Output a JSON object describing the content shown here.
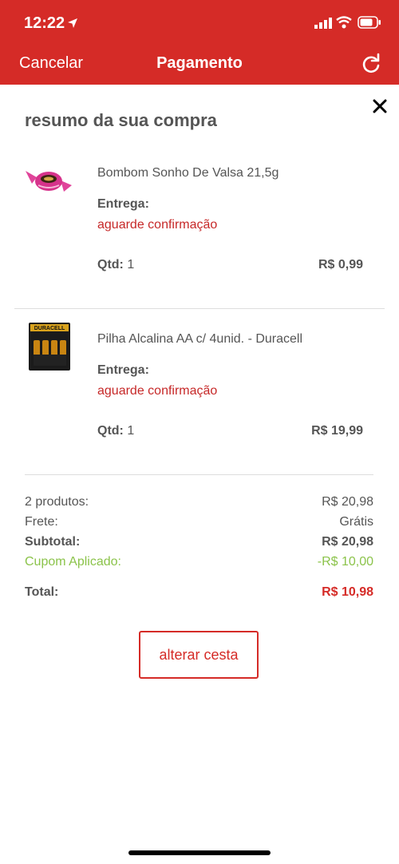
{
  "status_bar": {
    "time": "12:22"
  },
  "nav": {
    "cancel_label": "Cancelar",
    "title": "Pagamento"
  },
  "summary": {
    "title": "resumo da sua compra",
    "products": [
      {
        "name": "Bombom Sonho De Valsa 21,5g",
        "delivery_label": "Entrega:",
        "delivery_status": "aguarde confirmação",
        "qty_label": "Qtd:",
        "qty": "1",
        "price": "R$ 0,99"
      },
      {
        "name": "Pilha Alcalina AA c/ 4unid. - Duracell",
        "delivery_label": "Entrega:",
        "delivery_status": "aguarde confirmação",
        "qty_label": "Qtd:",
        "qty": "1",
        "price": "R$ 19,99",
        "image_text": "DURACELL"
      }
    ],
    "totals": {
      "products_label": "2 produtos:",
      "products_value": "R$ 20,98",
      "shipping_label": "Frete:",
      "shipping_value": "Grátis",
      "subtotal_label": "Subtotal:",
      "subtotal_value": "R$ 20,98",
      "coupon_label": "Cupom Aplicado:",
      "coupon_value": "-R$ 10,00",
      "total_label": "Total:",
      "total_value": "R$ 10,98"
    },
    "change_button": "alterar cesta"
  },
  "colors": {
    "brand": "#d52b27",
    "coupon": "#8bc34a",
    "text": "#555555"
  },
  "icons": [
    "location-arrow-icon",
    "signal-icon",
    "wifi-icon",
    "battery-icon",
    "refresh-icon",
    "close-icon"
  ]
}
